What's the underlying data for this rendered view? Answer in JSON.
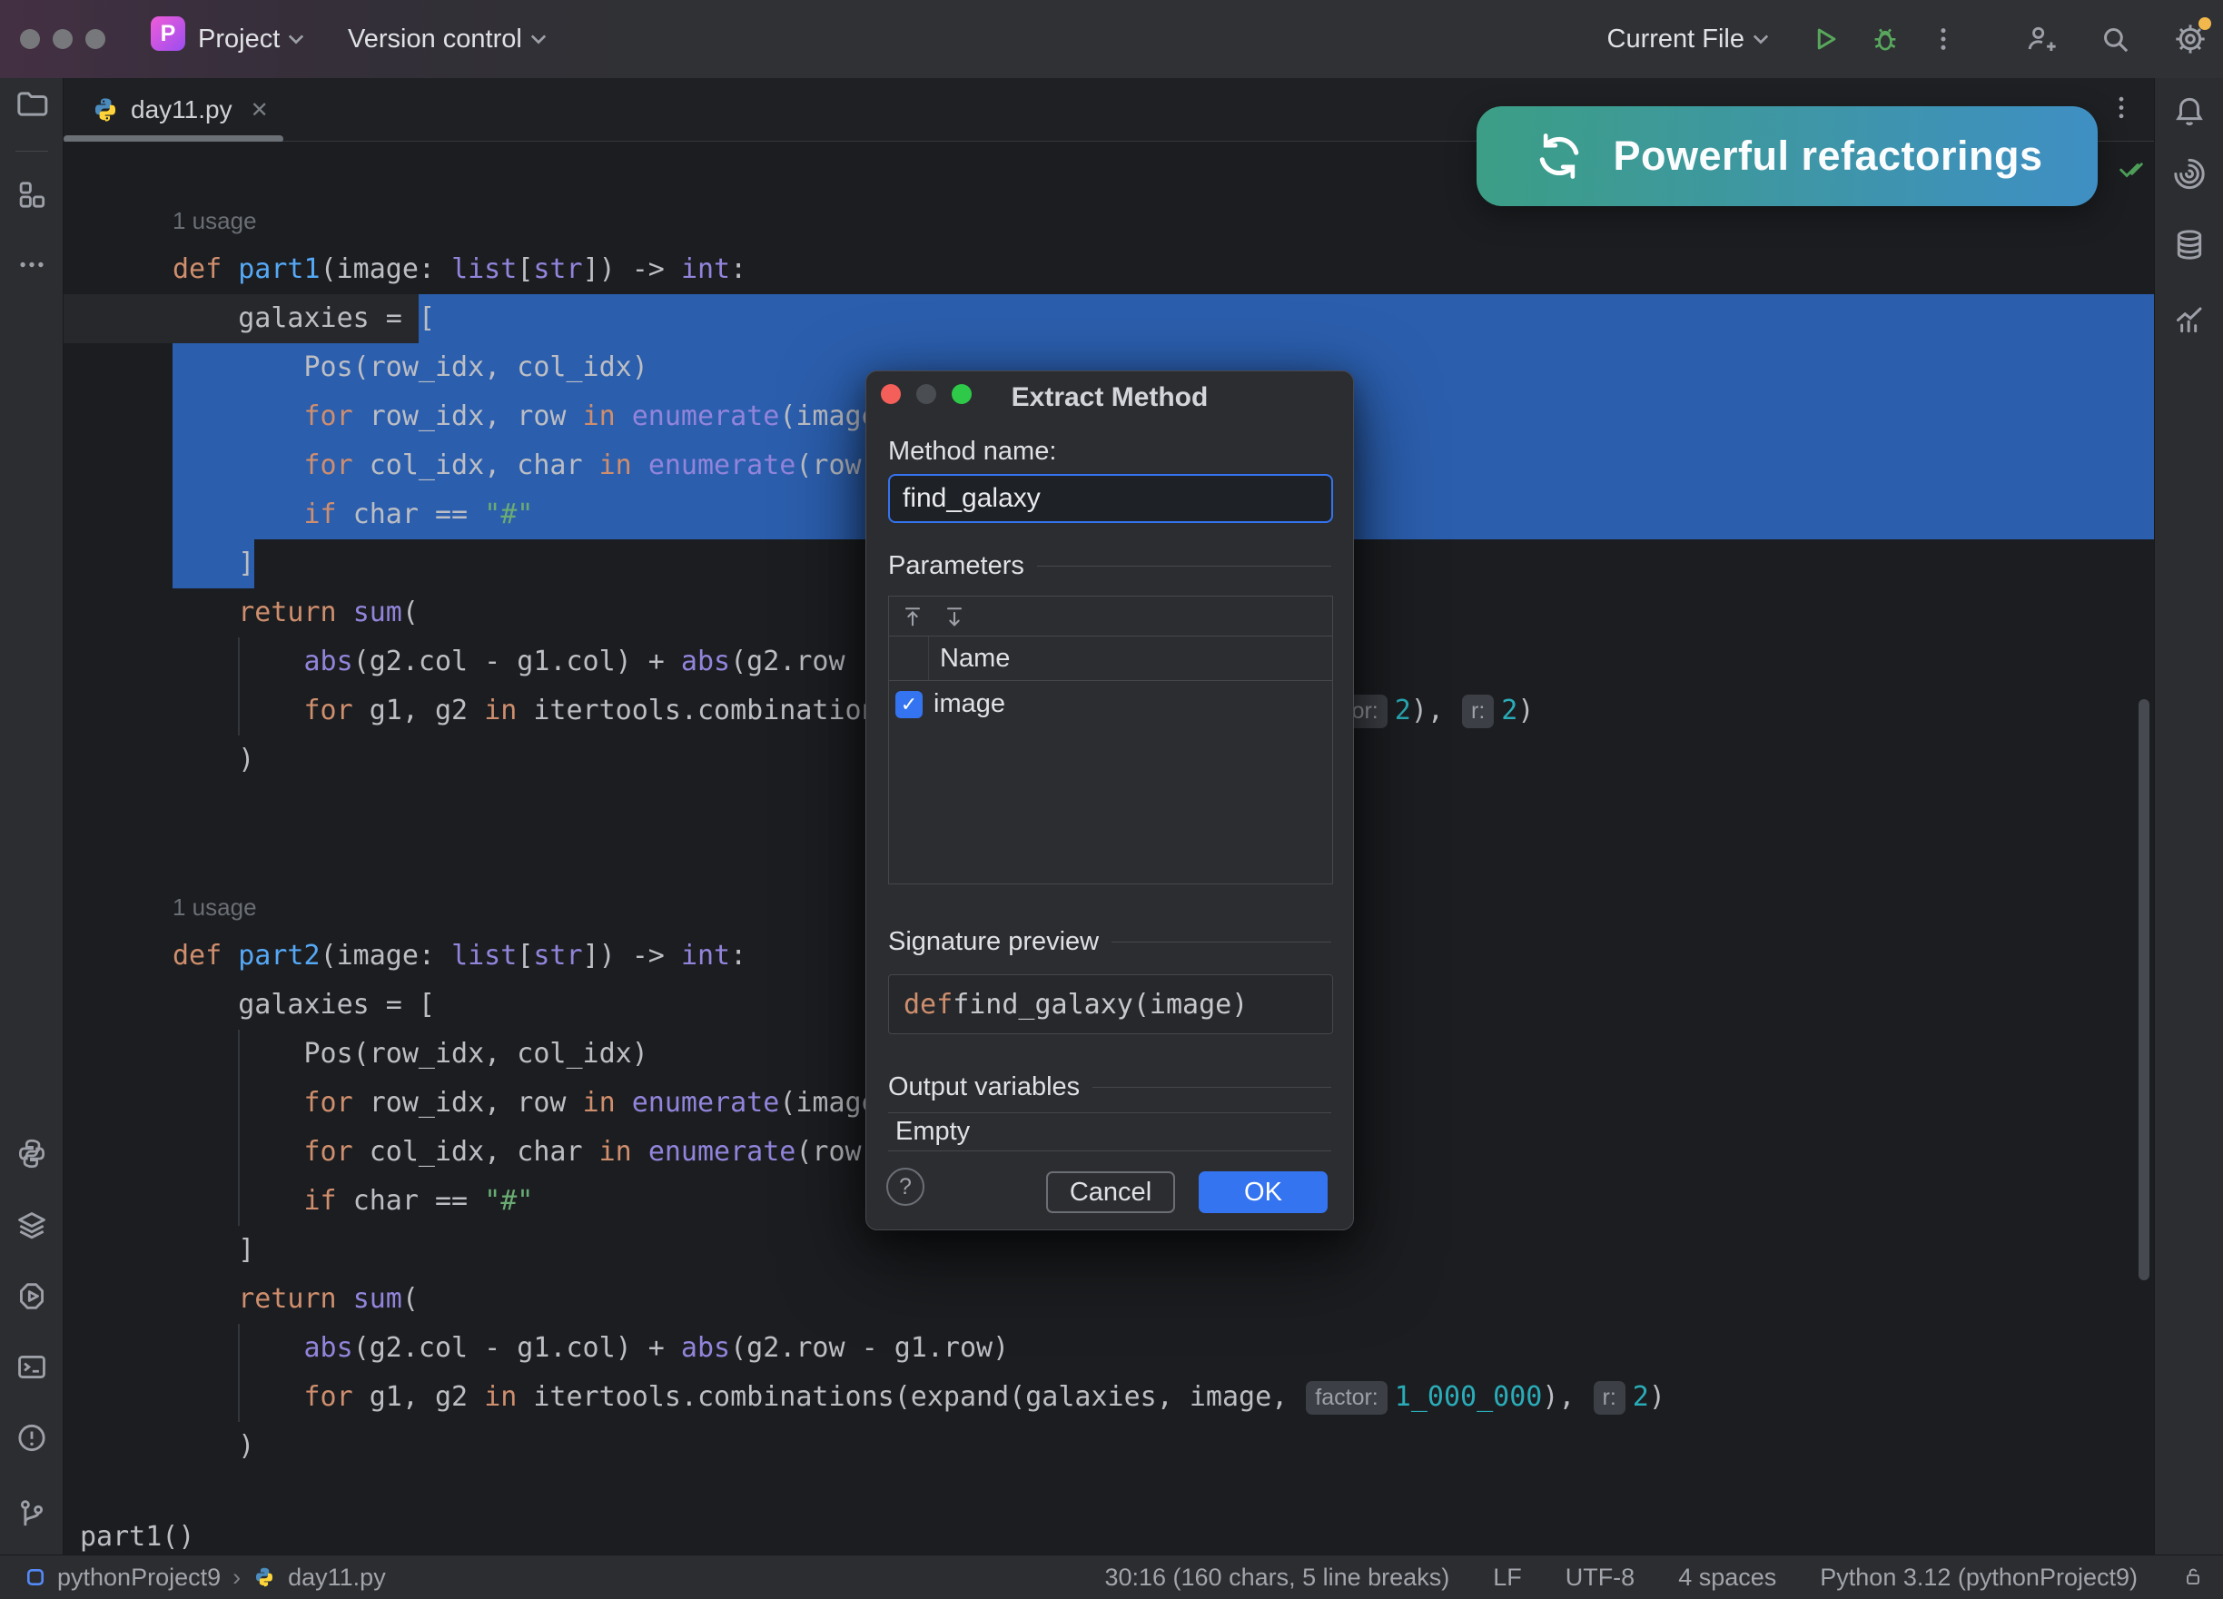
{
  "titlebar": {
    "project": "Project",
    "version_control": "Version control",
    "run_config": "Current File",
    "logo_letter": "P"
  },
  "tabbar": {
    "active_tab": "day11.py",
    "close_glyph": "✕",
    "more_glyph": "⋮"
  },
  "banner": {
    "label": "Powerful refactorings"
  },
  "editor": {
    "context_line": "part1()",
    "lines": [
      {
        "i": 0,
        "type": "hint",
        "text": "1 usage"
      },
      {
        "i": 1,
        "tok": [
          [
            "kw",
            "def "
          ],
          [
            "fn",
            "part1"
          ],
          [
            "d",
            "(image: "
          ],
          [
            "bi",
            "list"
          ],
          [
            "d",
            "["
          ],
          [
            "bi",
            "str"
          ],
          [
            "d",
            "]) -> "
          ],
          [
            "bi",
            "int"
          ],
          [
            "d",
            ":"
          ]
        ]
      },
      {
        "i": 2,
        "caret": true,
        "pre": [
          [
            "d",
            "    galaxies = "
          ]
        ],
        "sel": [
          [
            "d",
            "["
          ]
        ],
        "fill": true
      },
      {
        "i": 3,
        "sel": [
          [
            "d",
            "        Pos(row_idx, col_idx)"
          ]
        ],
        "fill": true
      },
      {
        "i": 4,
        "sel": [
          [
            "kw",
            "        for "
          ],
          [
            "d",
            "row_idx, row "
          ],
          [
            "kw",
            "in "
          ],
          [
            "bi",
            "enumerate"
          ],
          [
            "d",
            "(image)"
          ]
        ],
        "fill": true
      },
      {
        "i": 5,
        "sel": [
          [
            "kw",
            "        for "
          ],
          [
            "d",
            "col_idx, char "
          ],
          [
            "kw",
            "in "
          ],
          [
            "bi",
            "enumerate"
          ],
          [
            "d",
            "(row)"
          ]
        ],
        "fill": true
      },
      {
        "i": 6,
        "sel": [
          [
            "kw",
            "        if "
          ],
          [
            "d",
            "char == "
          ],
          [
            "s",
            "\"#\""
          ]
        ],
        "fill": true
      },
      {
        "i": 7,
        "sel": [
          [
            "d",
            "    ]"
          ]
        ],
        "fill": false
      },
      {
        "i": 8,
        "tok": [
          [
            "kw",
            "    return "
          ],
          [
            "bi",
            "sum"
          ],
          [
            "d",
            "("
          ]
        ]
      },
      {
        "i": 9,
        "tok": [
          [
            "d",
            "        "
          ],
          [
            "bi",
            "abs"
          ],
          [
            "d",
            "(g2.col - g1.col) + "
          ],
          [
            "bi",
            "abs"
          ],
          [
            "d",
            "(g2.row - g1.row)"
          ]
        ]
      },
      {
        "i": 10,
        "tok": [
          [
            "kw",
            "        for "
          ],
          [
            "d",
            "g1, g2 "
          ],
          [
            "kw",
            "in "
          ],
          [
            "d",
            "itertools.combinations(expand(galaxies, image, "
          ],
          [
            "ih",
            "factor:"
          ],
          [
            "n",
            "2"
          ],
          [
            "d",
            "), "
          ],
          [
            "ih",
            "r:"
          ],
          [
            "n",
            "2"
          ],
          [
            "d",
            ")"
          ]
        ]
      },
      {
        "i": 11,
        "tok": [
          [
            "d",
            "    )"
          ]
        ]
      },
      {
        "i": 14,
        "type": "hint",
        "text": "1 usage"
      },
      {
        "i": 15,
        "tok": [
          [
            "kw",
            "def "
          ],
          [
            "fn",
            "part2"
          ],
          [
            "d",
            "(image: "
          ],
          [
            "bi",
            "list"
          ],
          [
            "d",
            "["
          ],
          [
            "bi",
            "str"
          ],
          [
            "d",
            "]) -> "
          ],
          [
            "bi",
            "int"
          ],
          [
            "d",
            ":"
          ]
        ]
      },
      {
        "i": 16,
        "tok": [
          [
            "d",
            "    galaxies = ["
          ]
        ]
      },
      {
        "i": 17,
        "tok": [
          [
            "d",
            "        Pos(row_idx, col_idx)"
          ]
        ]
      },
      {
        "i": 18,
        "tok": [
          [
            "kw",
            "        for "
          ],
          [
            "d",
            "row_idx, row "
          ],
          [
            "kw",
            "in "
          ],
          [
            "bi",
            "enumerate"
          ],
          [
            "d",
            "(image)"
          ]
        ]
      },
      {
        "i": 19,
        "tok": [
          [
            "kw",
            "        for "
          ],
          [
            "d",
            "col_idx, char "
          ],
          [
            "kw",
            "in "
          ],
          [
            "bi",
            "enumerate"
          ],
          [
            "d",
            "(row)"
          ]
        ]
      },
      {
        "i": 20,
        "tok": [
          [
            "kw",
            "        if "
          ],
          [
            "d",
            "char == "
          ],
          [
            "s",
            "\"#\""
          ]
        ]
      },
      {
        "i": 21,
        "tok": [
          [
            "d",
            "    ]"
          ]
        ]
      },
      {
        "i": 22,
        "tok": [
          [
            "kw",
            "    return "
          ],
          [
            "bi",
            "sum"
          ],
          [
            "d",
            "("
          ]
        ]
      },
      {
        "i": 23,
        "tok": [
          [
            "d",
            "        "
          ],
          [
            "bi",
            "abs"
          ],
          [
            "d",
            "(g2.col - g1.col) + "
          ],
          [
            "bi",
            "abs"
          ],
          [
            "d",
            "(g2.row - g1.row)"
          ]
        ]
      },
      {
        "i": 24,
        "tok": [
          [
            "kw",
            "        for "
          ],
          [
            "d",
            "g1, g2 "
          ],
          [
            "kw",
            "in "
          ],
          [
            "d",
            "itertools.combinations(expand(galaxies, image, "
          ],
          [
            "ih",
            "factor:"
          ],
          [
            "n",
            "1_000_000"
          ],
          [
            "d",
            "), "
          ],
          [
            "ih",
            "r:"
          ],
          [
            "n",
            "2"
          ],
          [
            "d",
            ")"
          ]
        ]
      },
      {
        "i": 25,
        "tok": [
          [
            "d",
            "    )"
          ]
        ]
      }
    ]
  },
  "dialog": {
    "title": "Extract Method",
    "method_name_label": "Method name:",
    "method_name_value": "find_galaxy",
    "parameters_label": "Parameters",
    "name_column": "Name",
    "parameter_name": "image",
    "checkbox_glyph": "✓",
    "signature_label": "Signature preview",
    "signature_def": "def ",
    "signature_rest": "find_galaxy(image)",
    "output_label": "Output variables",
    "output_value": "Empty",
    "help_label": "?",
    "cancel_label": "Cancel",
    "ok_label": "OK"
  },
  "statusbar": {
    "project": "pythonProject9",
    "separator": "›",
    "file": "day11.py",
    "caret_position": "30:16 (160 chars, 5 line breaks)",
    "line_ending": "LF",
    "encoding": "UTF-8",
    "indent": "4 spaces",
    "interpreter": "Python 3.12 (pythonProject9)"
  },
  "colors": {
    "accent": "#3574F0",
    "selection": "#2B5EAD",
    "banner_start": "#3C9E85",
    "banner_end": "#3F8FC4"
  }
}
